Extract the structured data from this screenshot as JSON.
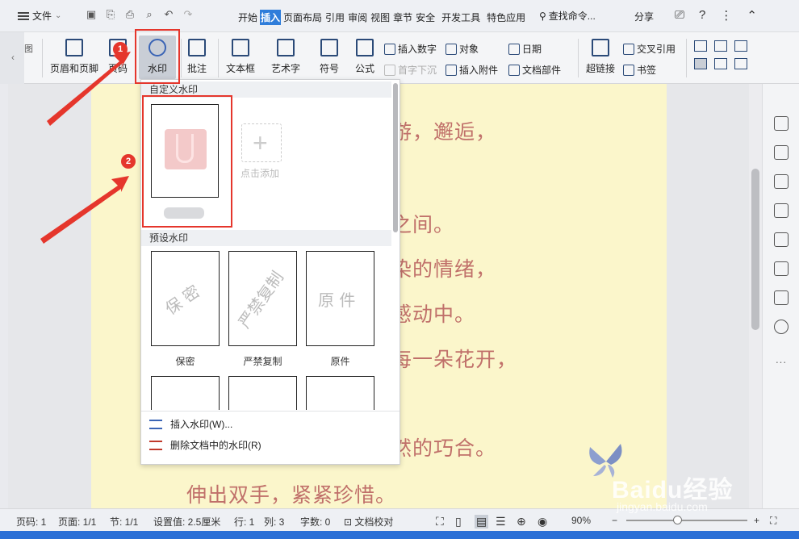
{
  "menubar": {
    "file_label": "文件",
    "tabs": [
      "开始",
      "插入",
      "页面布局",
      "引用",
      "审阅",
      "视图",
      "章节",
      "安全",
      "开发工具",
      "特色应用"
    ],
    "active_tab": "插入",
    "search_label": "查找命令...",
    "share_label": "分享"
  },
  "ribbon": {
    "left_cut": "图",
    "header_footer": "页眉和页脚",
    "page_number": "页码",
    "watermark": "水印",
    "comment": "批注",
    "textbox": "文本框",
    "wordart": "艺术字",
    "symbol": "符号",
    "formula": "公式",
    "insert_number": "插入数字",
    "object": "对象",
    "date": "日期",
    "dropcap": "首字下沉",
    "attachment": "插入附件",
    "doc_parts": "文档部件",
    "hyperlink": "超链接",
    "cross_ref": "交叉引用",
    "bookmark": "书签"
  },
  "dropdown": {
    "custom_header": "自定义水印",
    "add_label": "点击添加",
    "preset_header": "预设水印",
    "presets": [
      {
        "text": "保 密",
        "label": "保密"
      },
      {
        "text": "严禁复制",
        "label": "严禁复制"
      },
      {
        "text": "原 件",
        "label": "原件"
      }
    ],
    "insert_action": "插入水印(W)...",
    "remove_action": "删除文档中的水印(R)"
  },
  "document": {
    "lines": [
      "游，邂逅，",
      "之间。",
      "染的情绪，",
      "感动中。",
      "每一朵花开，",
      "然的巧合。",
      "伸出双手，紧紧珍惜。"
    ]
  },
  "statusbar": {
    "page_code": "页码: 1",
    "pages": "页面: 1/1",
    "section": "节: 1/1",
    "setting": "设置值: 2.5厘米",
    "row": "行: 1",
    "col": "列: 3",
    "word_count": "字数: 0",
    "proofread": "文档校对",
    "zoom": "90%"
  },
  "annotations": {
    "badge1": "1",
    "badge2": "2"
  },
  "watermark_site": {
    "name": "Baidu经验",
    "url": "jingyan.baidu.com"
  },
  "colors": {
    "accent": "#2f7dda",
    "highlight_red": "#e5362c",
    "page": "#fbf6cb",
    "doc_text": "#c0706a"
  }
}
